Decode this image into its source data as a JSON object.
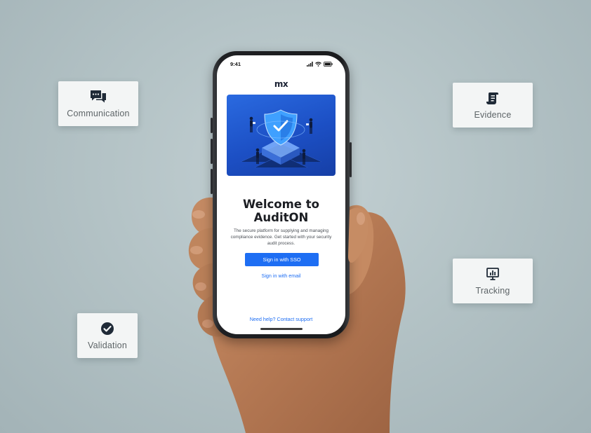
{
  "background": {
    "color": "#b4c3c6"
  },
  "cards": {
    "communication": {
      "label": "Communication",
      "icon": "chat-bubbles-icon"
    },
    "evidence": {
      "label": "Evidence",
      "icon": "scroll-document-icon"
    },
    "tracking": {
      "label": "Tracking",
      "icon": "presentation-chart-icon"
    },
    "validation": {
      "label": "Validation",
      "icon": "check-circle-icon"
    }
  },
  "phone": {
    "status_bar": {
      "time": "9:41",
      "icons": [
        "signal-icon",
        "wifi-icon",
        "battery-icon"
      ]
    },
    "logo": "mx",
    "hero": {
      "icon": "shield-check-illustration",
      "color": "#1c4fc4"
    },
    "welcome": {
      "line1": "Welcome to",
      "line2": "AuditON"
    },
    "intro": {
      "line1": "The secure platform for supplying and managing",
      "line2": "compliance evidence. Get started with your security",
      "line3": "audit process."
    },
    "sso_button": "Sign in with SSO",
    "email_link": "Sign in with email",
    "help": {
      "prefix": "Need help? ",
      "link": "Contact support"
    },
    "accent_color": "#1e6ef3"
  }
}
